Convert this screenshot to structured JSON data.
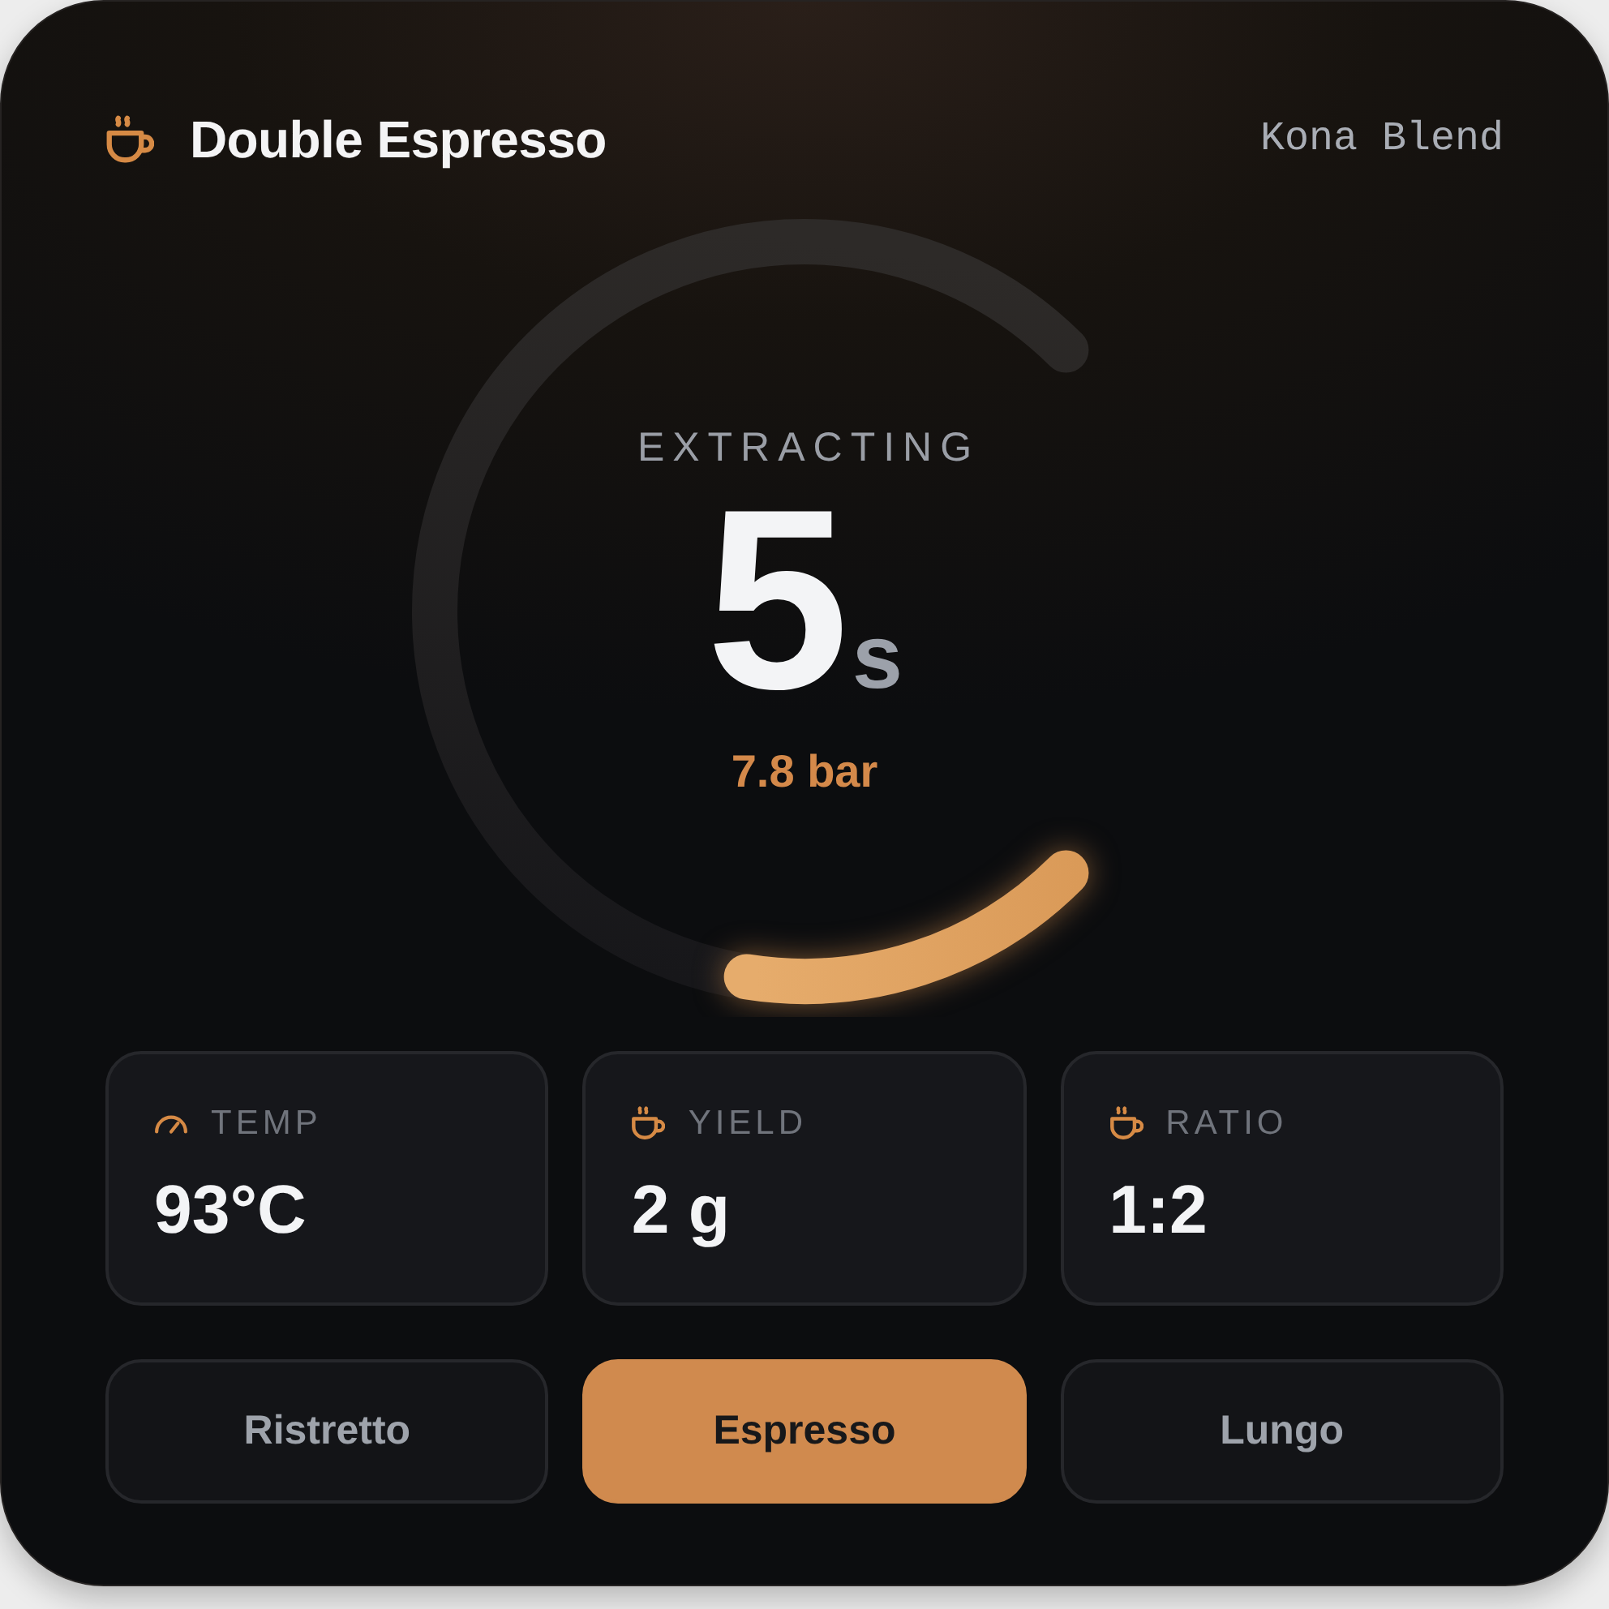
{
  "header": {
    "title": "Double Espresso",
    "blend": "Kona Blend"
  },
  "timer": {
    "status": "EXTRACTING",
    "value": "5",
    "unit": "s",
    "pressure": "7.8 bar",
    "level": 0.2
  },
  "stats": [
    {
      "kind": "gauge",
      "label": "TEMP",
      "value": "93°C"
    },
    {
      "kind": "cup",
      "label": "YIELD",
      "value": "2 g"
    },
    {
      "kind": "cup",
      "label": "RATIO",
      "value": "1:2"
    }
  ],
  "presets": [
    {
      "label": "Ristretto",
      "selected": false
    },
    {
      "label": "Espresso",
      "selected": true
    },
    {
      "label": "Lungo",
      "selected": false
    }
  ]
}
